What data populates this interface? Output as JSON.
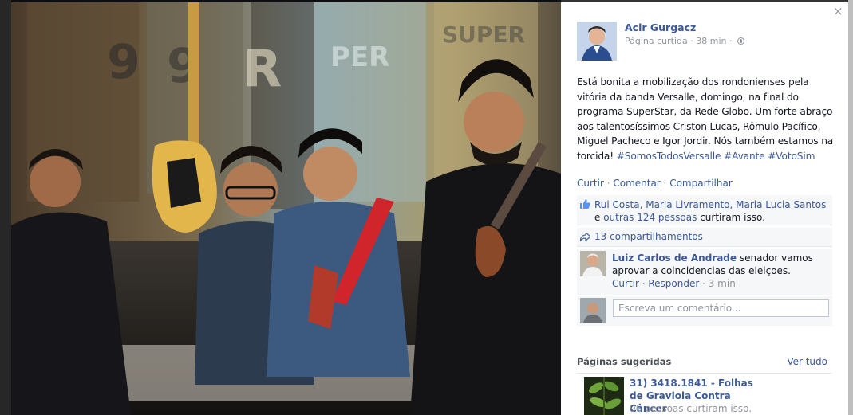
{
  "post": {
    "author": "Acir Gurgacz",
    "meta": "Página curtida · 38 min ·",
    "text_plain": "Está bonita a mobilização dos rondonienses pela vitória da banda Versalle, domingo, na final do programa SuperStar, da Rede Globo. Um forte abraço aos talentosíssimos Criston Lucas, Rômulo Pacífico, Miguel Pacheco e Igor Jordir. Nós também estamos na torcida!",
    "hashtags": [
      "#SomosTodosVersalle",
      "#Avante",
      "#VotoSim"
    ]
  },
  "actions": {
    "like": "Curtir",
    "comment": "Comentar",
    "share": "Compartilhar",
    "sep": " · "
  },
  "likes": {
    "names": "Rui Costa, Maria Livramento, Maria Lucia Santos",
    "and": " e ",
    "others": "outras 124 pessoas",
    "suffix": " curtiram isso."
  },
  "shares": {
    "label": "13 compartilhamentos"
  },
  "comment": {
    "author": "Luiz Carlos de Andrade",
    "text": " senador vamos aprovar a coincidencias das eleiçoes.",
    "like": "Curtir",
    "reply": "Responder",
    "time": "3 min"
  },
  "write_comment": {
    "placeholder": "Escreva um comentário..."
  },
  "suggested": {
    "title": "Páginas sugeridas",
    "see_all": "Ver tudo",
    "page_name": "31) 3418.1841 - Folhas de Graviola Contra Câncer",
    "page_likes": "96 pessoas curtiram isso."
  },
  "close": "×",
  "photo": {
    "icon": "photo-band-image",
    "colors": {
      "wall": "#6b5a3e",
      "guitar": "#e2b64a",
      "strap": "#d0262b"
    }
  }
}
